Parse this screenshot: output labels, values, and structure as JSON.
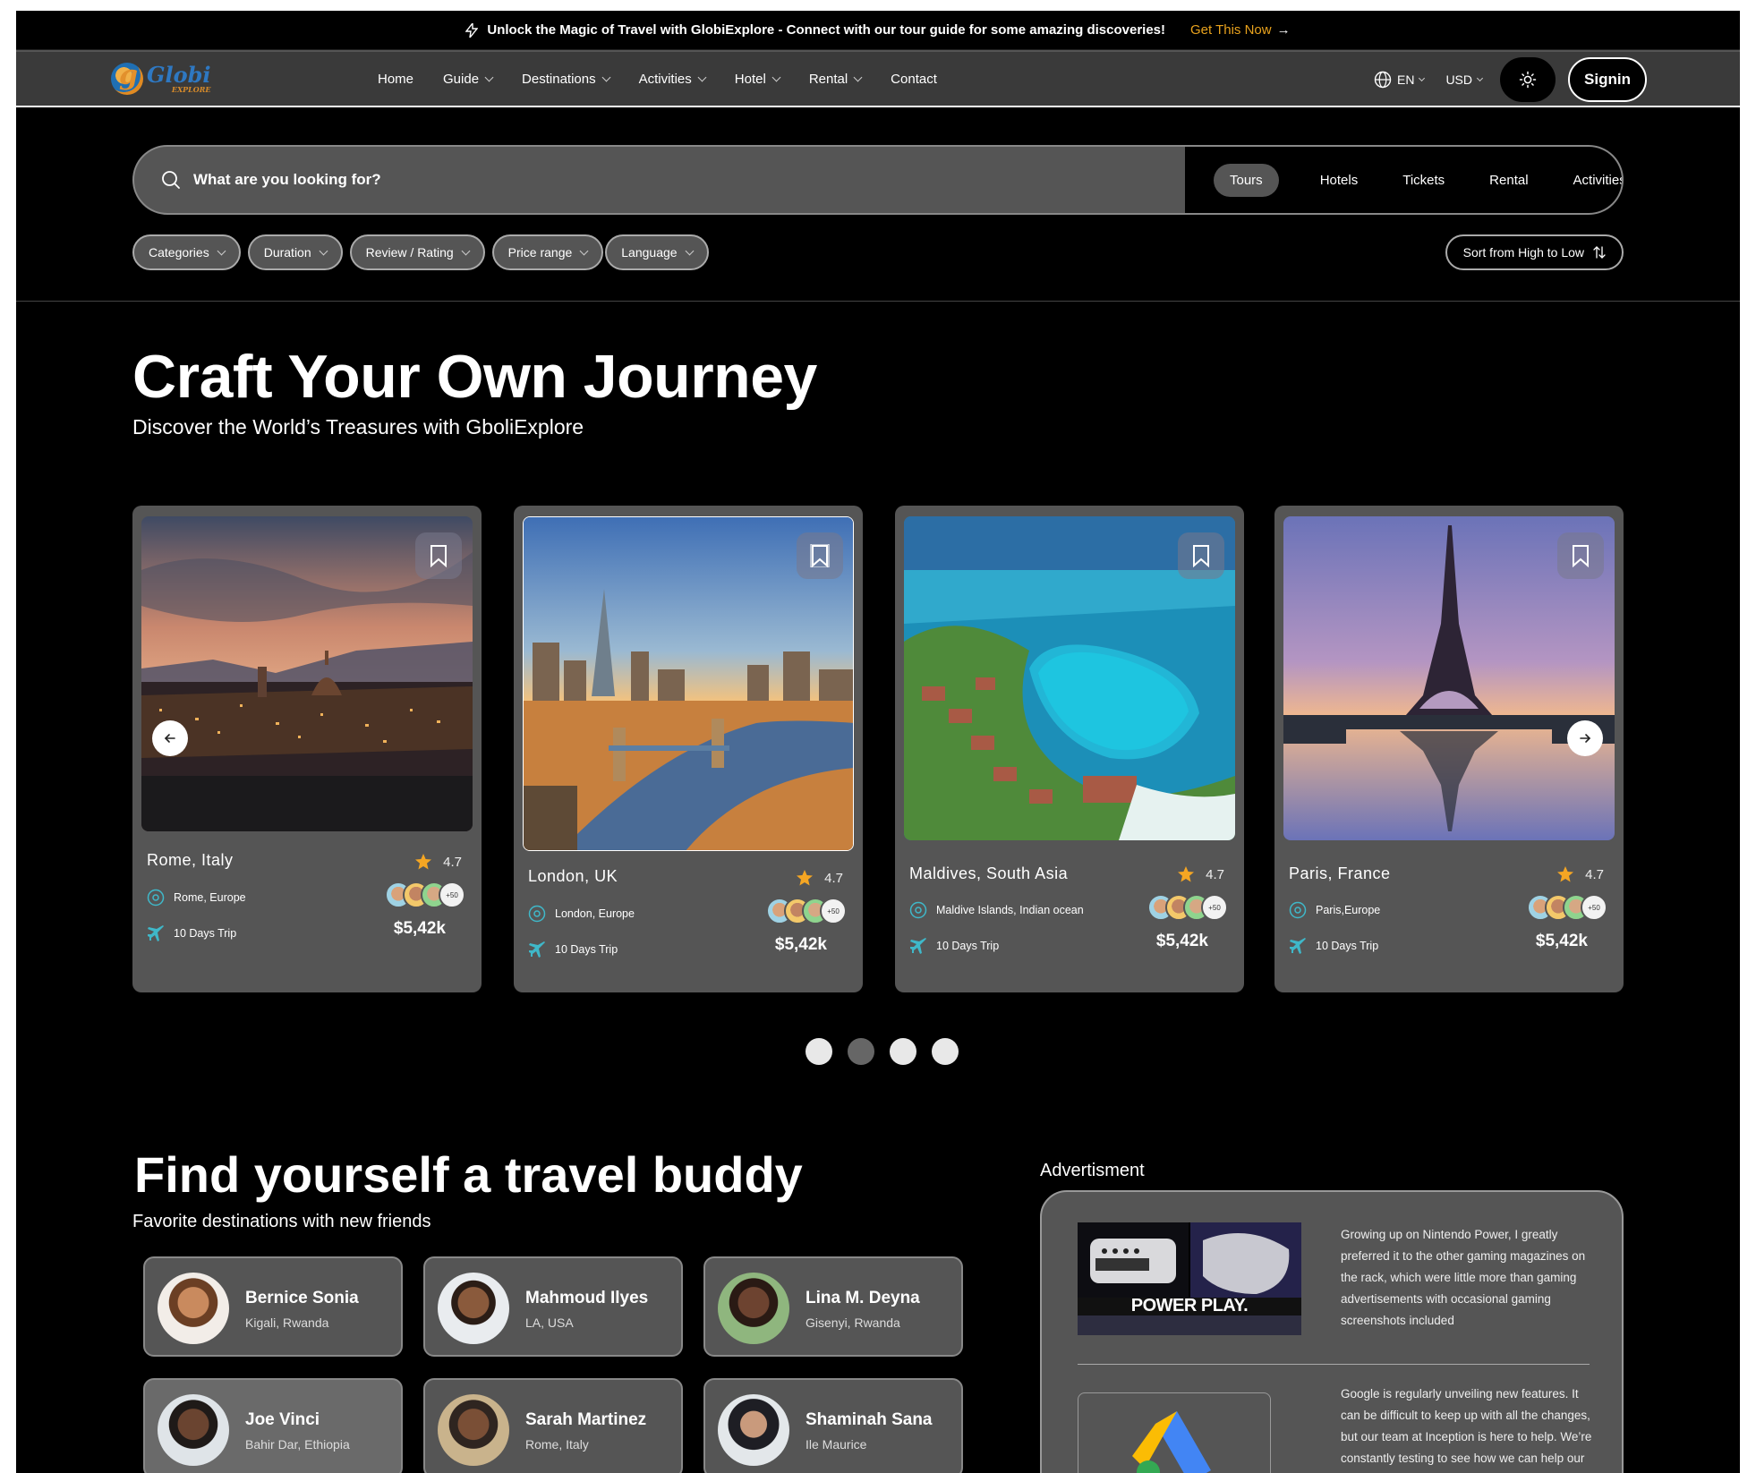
{
  "announcement": {
    "text": "Unlock the Magic of Travel with GlobiExplore - Connect with our tour guide for some amazing discoveries!",
    "cta": "Get This Now",
    "cta_arrow": "→"
  },
  "logo": {
    "word1": "Globi",
    "word2": "EXPLORE"
  },
  "nav": {
    "items": [
      {
        "label": "Home",
        "dropdown": false
      },
      {
        "label": "Guide",
        "dropdown": true
      },
      {
        "label": "Destinations",
        "dropdown": true
      },
      {
        "label": "Activities",
        "dropdown": true
      },
      {
        "label": "Hotel",
        "dropdown": true
      },
      {
        "label": "Rental",
        "dropdown": true
      },
      {
        "label": "Contact",
        "dropdown": false
      }
    ],
    "language": "EN",
    "currency": "USD",
    "signin": "Signin"
  },
  "search": {
    "placeholder": "What are you looking for?",
    "tabs": [
      "Tours",
      "Hotels",
      "Tickets",
      "Rental",
      "Activities"
    ],
    "active_tab": "Tours"
  },
  "filters": [
    "Categories",
    "Duration",
    "Review / Rating",
    "Price range",
    "Language"
  ],
  "sort": "Sort from High to Low",
  "hero": {
    "title": "Craft Your Own Journey",
    "subtitle": "Discover the World’s Treasures with GboliExplore"
  },
  "tours": [
    {
      "name": "Rome, Italy",
      "rating": "4.7",
      "location": "Rome, Europe",
      "trip": "10 Days Trip",
      "price": "$5,42k",
      "more": "+50"
    },
    {
      "name": "London, UK",
      "rating": "4.7",
      "location": "London, Europe",
      "trip": "10 Days Trip",
      "price": "$5,42k",
      "more": "+50"
    },
    {
      "name": "Maldives, South Asia",
      "rating": "4.7",
      "location": "Maldive Islands, Indian ocean",
      "trip": "10 Days Trip",
      "price": "$5,42k",
      "more": "+50"
    },
    {
      "name": "Paris, France",
      "rating": "4.7",
      "location": "Paris,Europe",
      "trip": "10 Days Trip",
      "price": "$5,42k",
      "more": "+50"
    }
  ],
  "carousel": {
    "active_dot": 2,
    "dot_count": 4
  },
  "buddies": {
    "title": "Find yourself a travel buddy",
    "subtitle": "Favorite destinations with new friends",
    "people": [
      {
        "name": "Bernice Sonia",
        "location": "Kigali, Rwanda"
      },
      {
        "name": "Mahmoud Ilyes",
        "location": "LA, USA"
      },
      {
        "name": "Lina M. Deyna",
        "location": "Gisenyi, Rwanda"
      },
      {
        "name": "Joe Vinci",
        "location": "Bahir Dar, Ethiopia"
      },
      {
        "name": "Sarah Martinez",
        "location": "Rome, Italy"
      },
      {
        "name": "Shaminah Sana",
        "location": "Ile Maurice"
      }
    ]
  },
  "advertisement": {
    "label": "Advertisment",
    "ad1_caption": "POWER PLAY.",
    "ad1_text": "Growing up on Nintendo Power, I greatly preferred it to the other gaming magazines on the rack, which were little more than gaming advertisements with occasional gaming screenshots included",
    "ad2_text": "Google is regularly unveiling new features. It can be difficult to keep up with all the changes, but our team at Inception is here to help. We’re constantly testing to see how we can help our clients dominate their"
  },
  "colors": {
    "accent": "#e8a21d",
    "card_bg": "#555555",
    "page_bg": "#000000",
    "star": "#f5a623",
    "teal_icon": "#3fb8c9"
  }
}
